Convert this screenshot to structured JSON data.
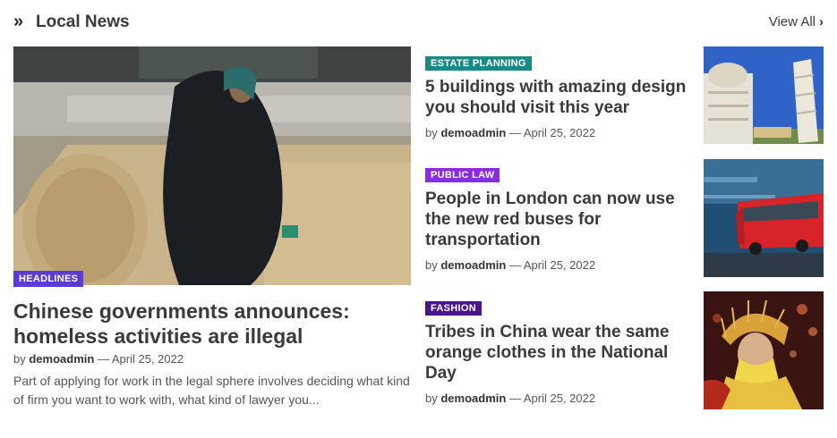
{
  "header": {
    "icon": "double-chevron-right-icon",
    "icon_glyph": "»",
    "title": "Local News",
    "view_all_label": "View All",
    "view_all_chevron": "›"
  },
  "featured": {
    "category": "HEADLINES",
    "category_color": "#5a3ad8",
    "title": "Chinese governments announces: homeless activities are illegal",
    "by": "by",
    "author": "demoadmin",
    "separator": "—",
    "date": "April 25, 2022",
    "excerpt": "Part of applying for work in the legal sphere involves deciding what kind of firm you want to work with, what kind of lawyer you..."
  },
  "items": [
    {
      "category": "ESTATE PLANNING",
      "category_color": "#1a8a86",
      "title": "5 buildings with amazing design you should visit this year",
      "by": "by",
      "author": "demoadmin",
      "separator": "—",
      "date": "April 25, 2022"
    },
    {
      "category": "PUBLIC LAW",
      "category_color": "#8a2be2",
      "title": "People in London can now use the new red buses for transportation",
      "by": "by",
      "author": "demoadmin",
      "separator": "—",
      "date": "April 25, 2022"
    },
    {
      "category": "FASHION",
      "category_color": "#4b148c",
      "title": "Tribes in China wear the same orange clothes in the National Day",
      "by": "by",
      "author": "demoadmin",
      "separator": "—",
      "date": "April 25, 2022"
    }
  ]
}
